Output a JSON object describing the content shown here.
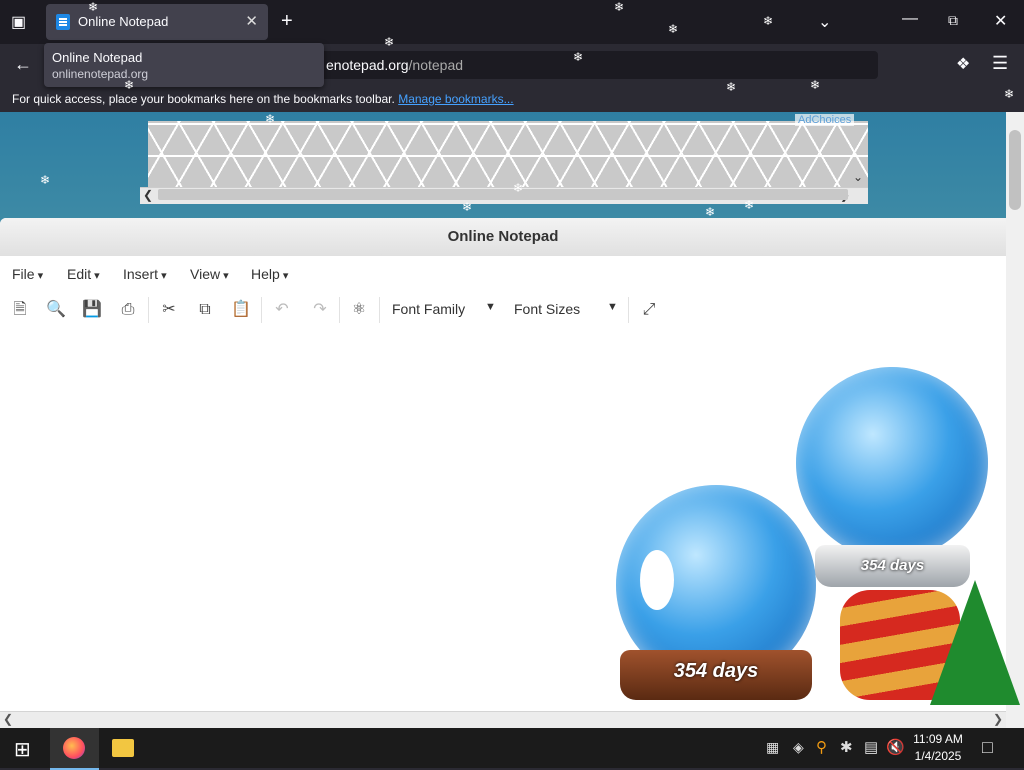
{
  "browser": {
    "tab_title": "Online Notepad",
    "tooltip_title": "Online Notepad",
    "tooltip_url": "onlinenotepad.org",
    "url_host": "enotepad.org",
    "url_path": "/notepad",
    "bookmarks_message": "For quick access, place your bookmarks here on the bookmarks toolbar.",
    "bookmarks_link": "Manage bookmarks...",
    "new_tab": "+",
    "close_tab": "✕"
  },
  "ad": {
    "adchoices": "AdChoices"
  },
  "notepad": {
    "title": "Online Notepad",
    "menus": [
      "File",
      "Edit",
      "Insert",
      "View",
      "Help"
    ],
    "font_family_label": "Font Family",
    "font_sizes_label": "Font Sizes"
  },
  "decoration": {
    "globe_small_text": "354 days",
    "globe_large_text": "354 days"
  },
  "taskbar": {
    "time": "11:09 AM",
    "date": "1/4/2025"
  }
}
